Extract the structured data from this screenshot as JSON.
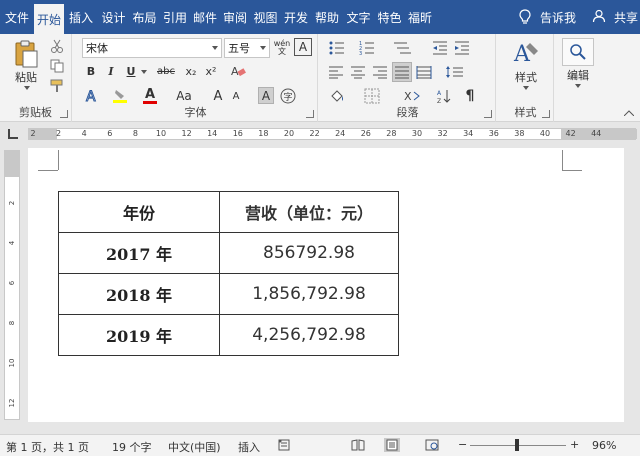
{
  "menubar": {
    "tabs": [
      "文件",
      "开始",
      "插入",
      "设计",
      "布局",
      "引用",
      "邮件",
      "审阅",
      "视图",
      "开发",
      "帮助",
      "文字",
      "特色",
      "福昕"
    ],
    "active_tab": "开始",
    "tell_me": "告诉我",
    "share": "共享"
  },
  "ribbon": {
    "clipboard": {
      "paste_label": "粘贴",
      "group_label": "剪贴板"
    },
    "font": {
      "font_name": "宋体",
      "font_size": "五号",
      "bold": "B",
      "italic": "I",
      "underline": "U",
      "strike": "abc",
      "subscript": "x₂",
      "superscript": "x²",
      "font_color_glyph": "A",
      "case": "Aa",
      "grow": "A",
      "shrink": "A",
      "charbox": "A",
      "phonetic": "wén",
      "group_label": "字体"
    },
    "paragraph": {
      "group_label": "段落"
    },
    "styles": {
      "styles_label": "样式",
      "group_label": "样式"
    },
    "editing": {
      "edit_label": "编辑"
    }
  },
  "ruler": {
    "ticks": [
      "2",
      "2",
      "4",
      "6",
      "8",
      "10",
      "12",
      "14",
      "16",
      "18",
      "20",
      "22",
      "24",
      "26",
      "28",
      "30",
      "32",
      "34",
      "36",
      "38",
      "40",
      "42",
      "44"
    ]
  },
  "vruler": {
    "ticks": [
      "2",
      "4",
      "6",
      "8",
      "10",
      "12"
    ]
  },
  "table": {
    "headers": [
      "年份",
      "营收（单位：元）"
    ],
    "rows": [
      {
        "year": "2017 年",
        "revenue": "856792.98"
      },
      {
        "year": "2018 年",
        "revenue": "1,856,792.98"
      },
      {
        "year": "2019 年",
        "revenue": "4,256,792.98"
      }
    ]
  },
  "status": {
    "page": "第 1 页，共 1 页",
    "words": "19 个字",
    "language": "中文(中国)",
    "insert_mode": "插入",
    "zoom_minus": "−",
    "zoom_plus": "+",
    "zoom": "96%"
  }
}
